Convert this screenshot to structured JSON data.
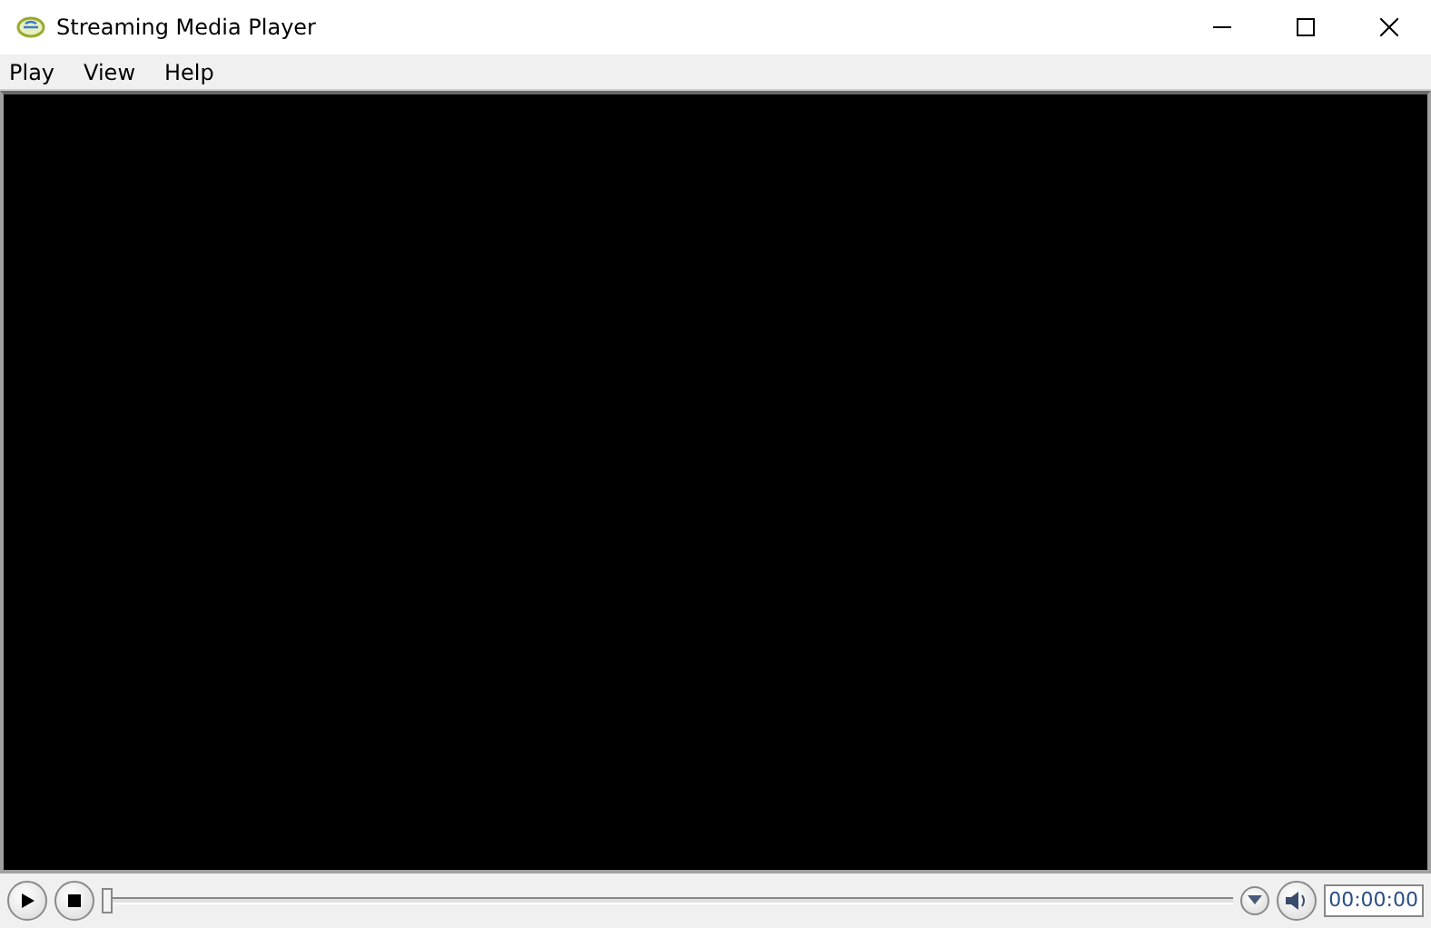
{
  "window": {
    "title": "Streaming Media Player"
  },
  "menu": [
    {
      "label": "Play"
    },
    {
      "label": "View"
    },
    {
      "label": "Help"
    }
  ],
  "controls": {
    "seek": {
      "level": 0
    },
    "time": "00:00:00"
  }
}
